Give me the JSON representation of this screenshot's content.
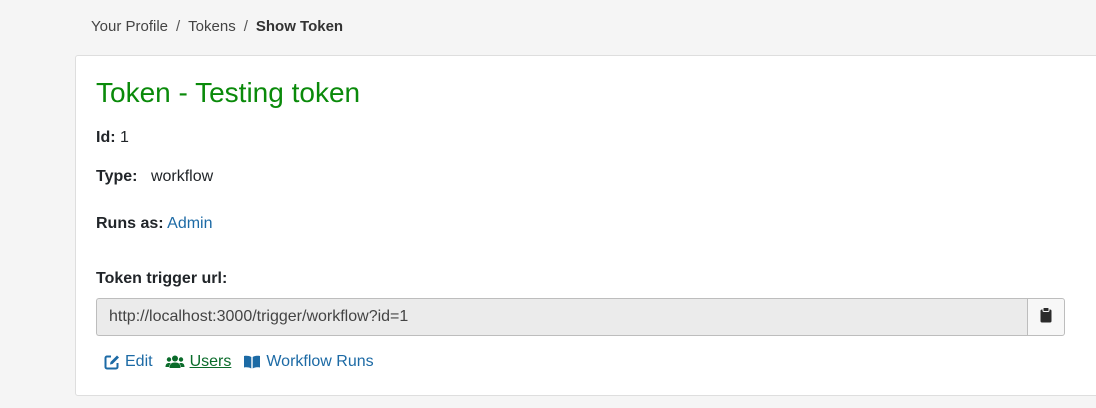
{
  "breadcrumb": {
    "items": [
      "Your Profile",
      "Tokens"
    ],
    "current": "Show Token",
    "separator": "/"
  },
  "token": {
    "title": "Token - Testing token",
    "id_label": "Id:",
    "id_value": "1",
    "type_label": "Type:",
    "type_value": "workflow",
    "runs_as_label": "Runs as:",
    "runs_as_value": "Admin",
    "url_label": "Token trigger url:",
    "url_value": "http://localhost:3000/trigger/workflow?id=1"
  },
  "actions": {
    "edit_label": "Edit",
    "users_label": "Users",
    "workflow_runs_label": "Workflow Runs"
  },
  "icons": {
    "copy": "clipboard-icon",
    "edit": "edit-icon",
    "users": "users-icon",
    "workflow_runs": "book-icon"
  },
  "colors": {
    "title": "#0a8a0a",
    "link": "#1c6aa5",
    "users_link": "#0a6b2a"
  }
}
